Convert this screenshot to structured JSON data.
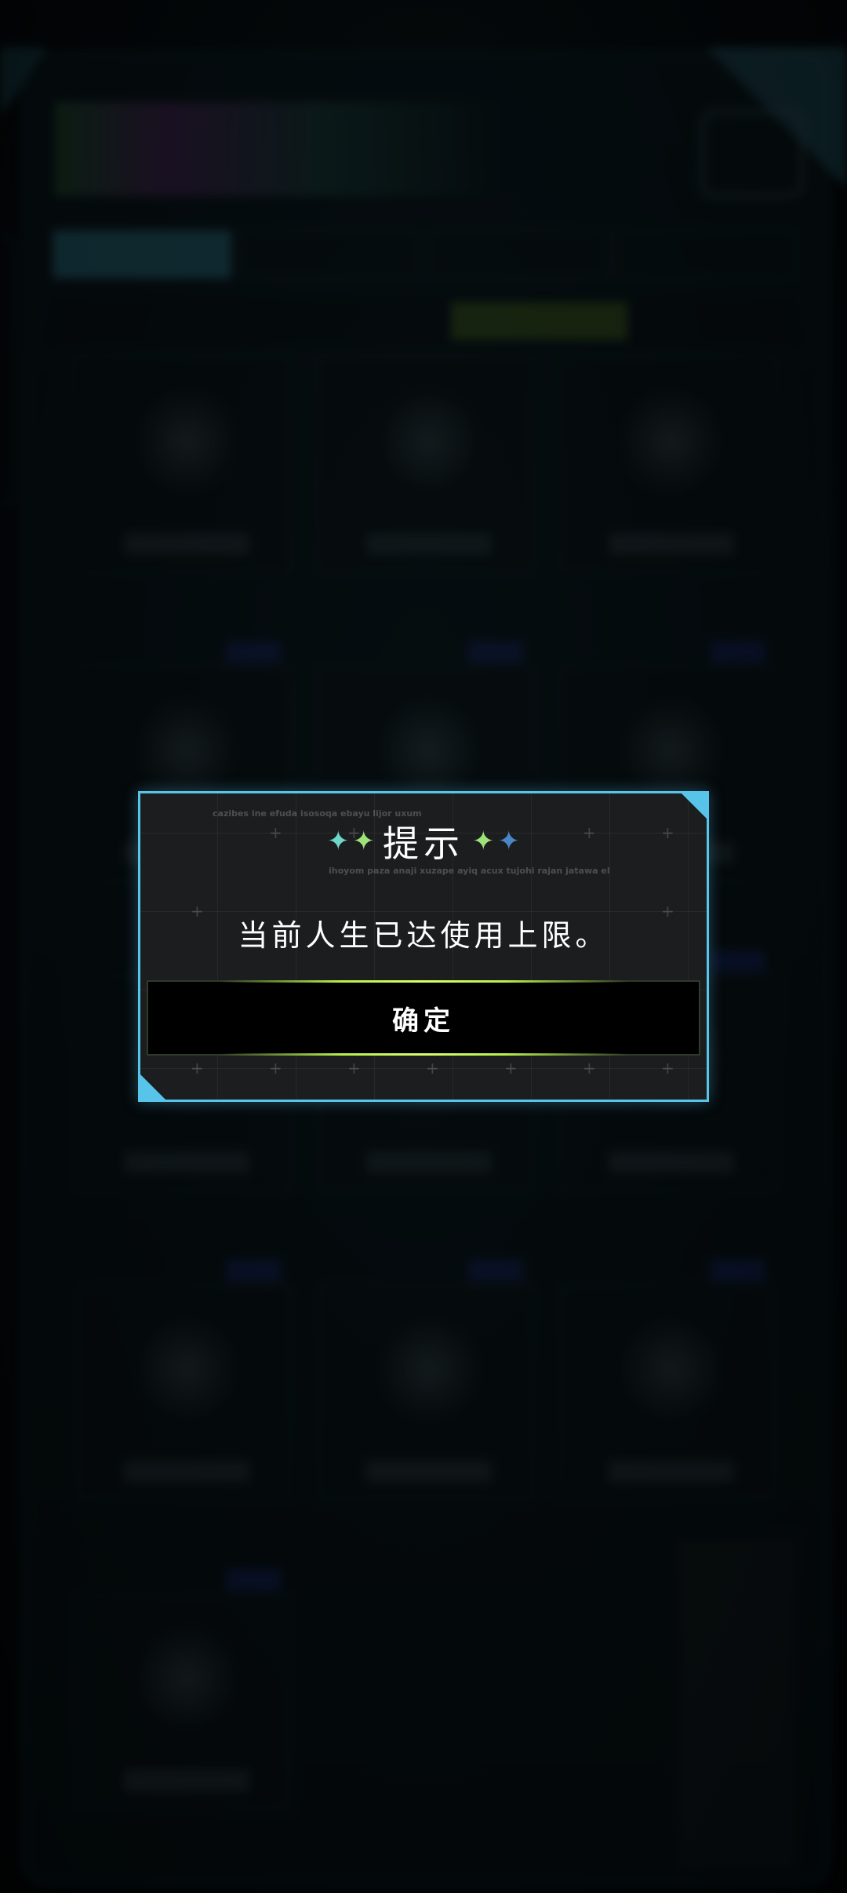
{
  "dialog": {
    "title": "提示",
    "message": "当前人生已达使用上限。",
    "confirm_label": "确定",
    "decoration_text_1": "cazibes ine efuda isosoqa ebayu lijor uxum",
    "decoration_text_2": "ihoyom paza anaji xuzape ayiq acux tujohi rajan jatawa el",
    "title_stars": [
      "four-point-star-icon",
      "four-point-star-icon",
      "four-point-star-icon",
      "four-point-star-icon"
    ]
  },
  "colors": {
    "dialog_border": "#58c4ea",
    "dialog_background": "#1b1d1f",
    "button_glow": "#b8f04a",
    "star_teal": "#6fd6c8",
    "star_green": "#9ee37a",
    "star_blue": "#4a86c8"
  }
}
